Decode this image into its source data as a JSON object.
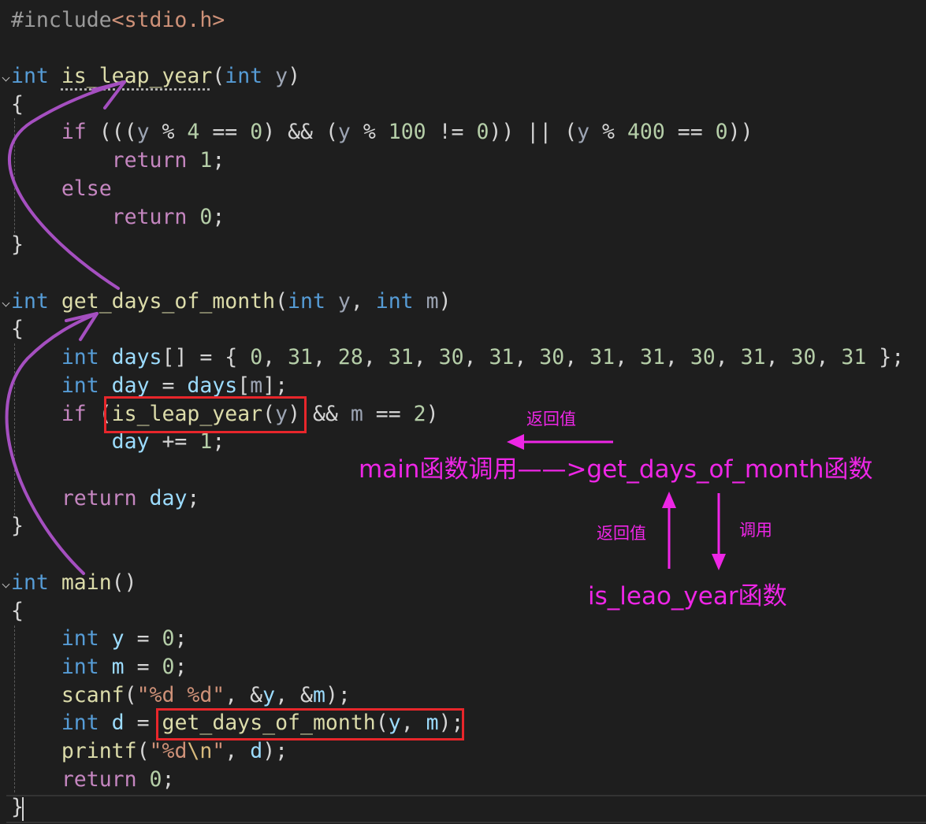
{
  "editor": {
    "lines": {
      "l1": {
        "a": "#include",
        "b": "<stdio.h>"
      },
      "l3": {
        "a": "int",
        "b": " ",
        "c": "is_leap_year",
        "d": "(",
        "e": "int",
        "f": " y",
        "g": ")"
      },
      "l4": {
        "a": "{"
      },
      "l5": {
        "a": "    ",
        "b": "if",
        "c": " (((",
        "d": "y",
        "e": " % ",
        "f": "4",
        "g": " == ",
        "h": "0",
        "i": ") && (",
        "j": "y",
        "k": " % ",
        "l": "100",
        "m": " != ",
        "n": "0",
        "o": ")) || (",
        "p": "y",
        "q": " % ",
        "r": "400",
        "s": " == ",
        "t": "0",
        "u": "))"
      },
      "l6": {
        "a": "        ",
        "b": "return",
        "c": " ",
        "d": "1",
        "e": ";"
      },
      "l7": {
        "a": "    ",
        "b": "else"
      },
      "l8": {
        "a": "        ",
        "b": "return",
        "c": " ",
        "d": "0",
        "e": ";"
      },
      "l9": {
        "a": "}"
      },
      "l11": {
        "a": "int",
        "b": " ",
        "c": "get_days_of_month",
        "d": "(",
        "e": "int",
        "f": " y",
        "g": ", ",
        "h": "int",
        "i": " m",
        "j": ")"
      },
      "l12": {
        "a": "{"
      },
      "l13": {
        "a": "    ",
        "b": "int",
        "c": " ",
        "d": "days",
        "e": "[] = { ",
        "f": "0",
        "g": ", ",
        "h": "31",
        "i": ", ",
        "j": "28",
        "k": ", ",
        "l": "31",
        "m": ", ",
        "n": "30",
        "o": ", ",
        "p": "31",
        "q": ", ",
        "r": "30",
        "s": ", ",
        "t": "31",
        "u": ", ",
        "v": "31",
        "w": ", ",
        "x": "30",
        "y": ", ",
        "z": "31",
        "aa": ", ",
        "ab": "30",
        "ac": ", ",
        "ad": "31",
        "ae": " };"
      },
      "l14": {
        "a": "    ",
        "b": "int",
        "c": " ",
        "d": "day",
        "e": " = ",
        "f": "days",
        "g": "[",
        "h": "m",
        "i": "];"
      },
      "l15": {
        "a": "    ",
        "b": "if",
        "c": " (",
        "d": "is_leap_year",
        "e": "(",
        "f": "y",
        "g": ") && ",
        "h": "m",
        "i": " == ",
        "j": "2",
        "k": ")"
      },
      "l16": {
        "a": "        ",
        "b": "day",
        "c": " += ",
        "d": "1",
        "e": ";"
      },
      "l18": {
        "a": "    ",
        "b": "return",
        "c": " ",
        "d": "day",
        "e": ";"
      },
      "l19": {
        "a": "}"
      },
      "l21": {
        "a": "int",
        "b": " ",
        "c": "main",
        "d": "()"
      },
      "l22": {
        "a": "{"
      },
      "l23": {
        "a": "    ",
        "b": "int",
        "c": " ",
        "d": "y",
        "e": " = ",
        "f": "0",
        "g": ";"
      },
      "l24": {
        "a": "    ",
        "b": "int",
        "c": " ",
        "d": "m",
        "e": " = ",
        "f": "0",
        "g": ";"
      },
      "l25": {
        "a": "    ",
        "b": "scanf",
        "c": "(",
        "d": "\"%d %d\"",
        "e": ", &",
        "f": "y",
        "g": ", &",
        "h": "m",
        "i": ");"
      },
      "l26": {
        "a": "    ",
        "b": "int",
        "c": " ",
        "d": "d",
        "e": " = ",
        "f": "get_days_of_month",
        "g": "(",
        "h": "y",
        "i": ", ",
        "j": "m",
        "k": ");"
      },
      "l27": {
        "a": "    ",
        "b": "printf",
        "c": "(",
        "d": "\"%d",
        "e": "\\n",
        "f": "\"",
        "g": ", ",
        "h": "d",
        "i": ");"
      },
      "l28": {
        "a": "    ",
        "b": "return",
        "c": " ",
        "d": "0",
        "e": ";"
      },
      "l29": {
        "a": "}"
      }
    }
  },
  "annotations": {
    "return_value_top": "返回值",
    "main_calls": "main函数调用——>get_days_of_month函数",
    "return_value_left": "返回值",
    "calls_right": "调用",
    "is_leap_label": "is_leao_year函数",
    "annotation_color": "#ee26e6",
    "arrow_color": "#a54fc0",
    "box_color": "#e8262b"
  }
}
